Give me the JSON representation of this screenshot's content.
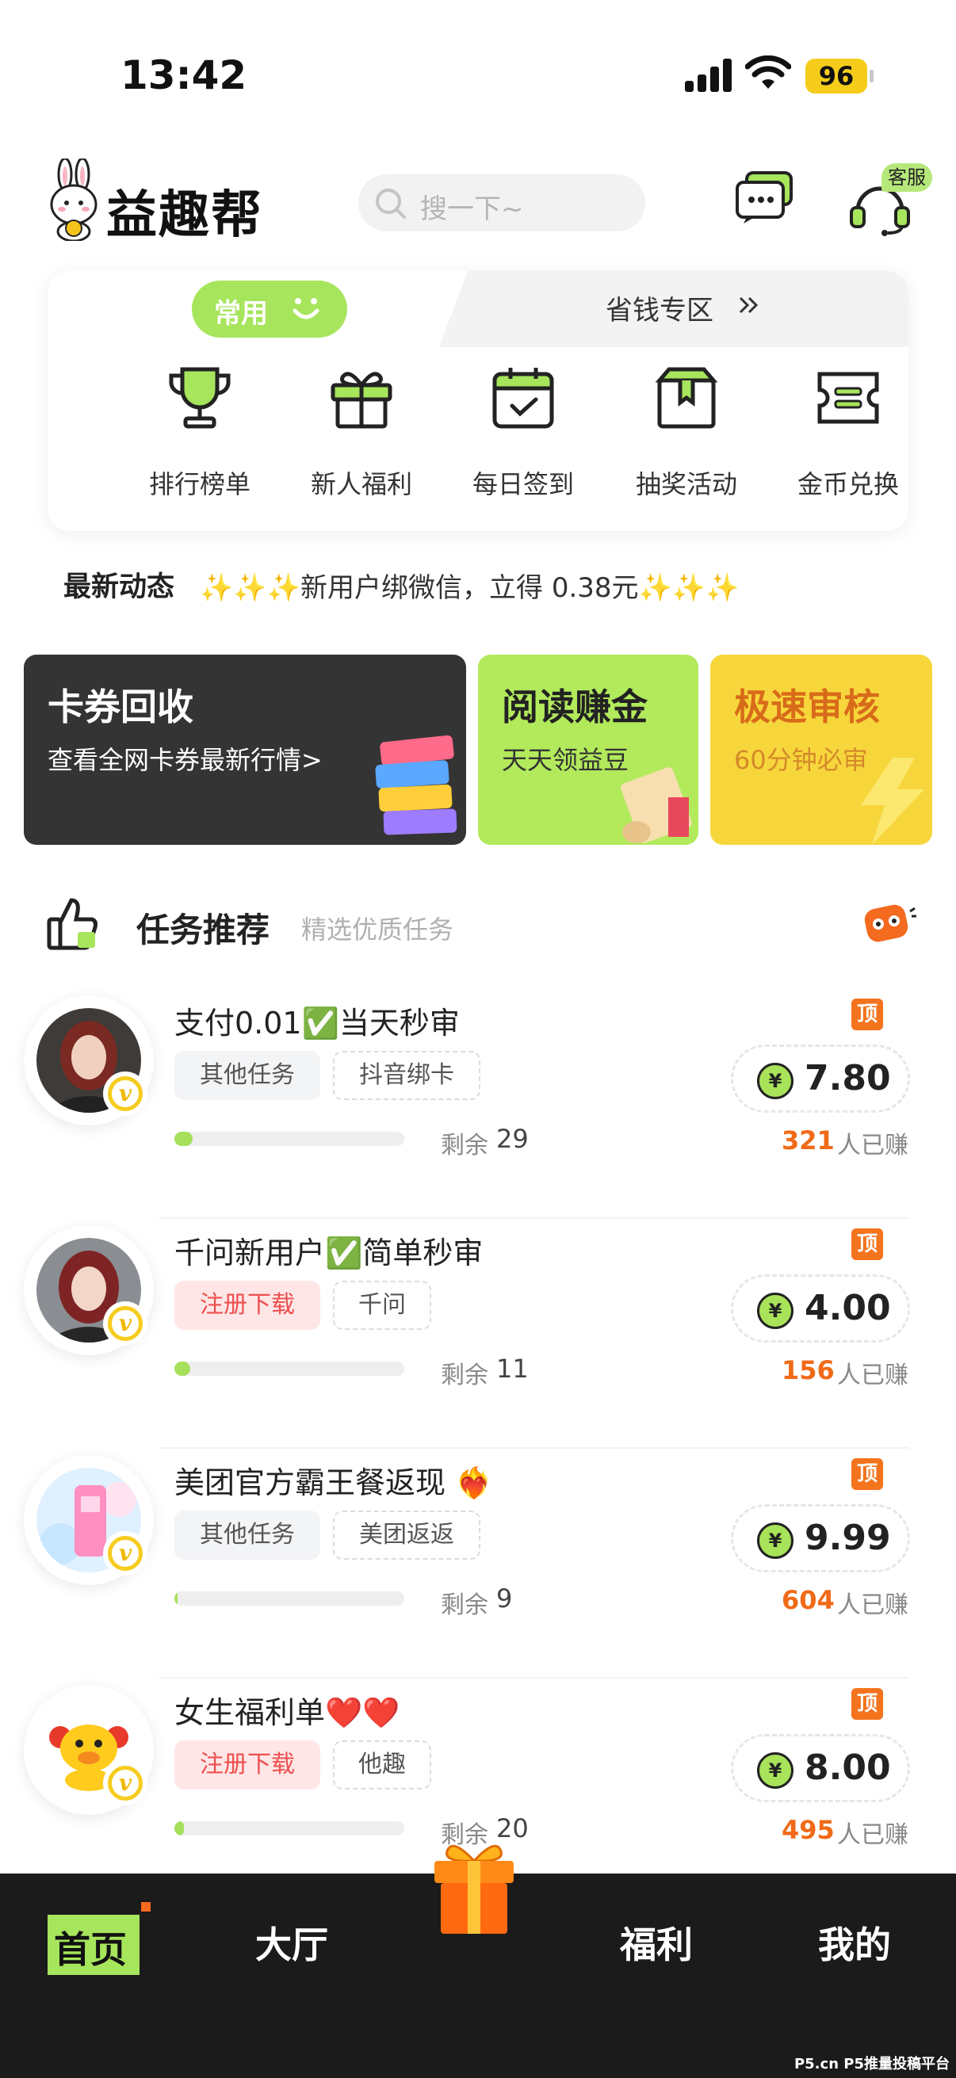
{
  "status_bar": {
    "time": "13:42",
    "battery": "96"
  },
  "header": {
    "app_name": "益趣帮",
    "search_placeholder": "搜一下~",
    "customer_service_tag": "客服"
  },
  "quick_card": {
    "tab_common": "常用",
    "tab_save": "省钱专区",
    "items": [
      {
        "label": "排行榜单",
        "icon": "trophy-icon"
      },
      {
        "label": "新人福利",
        "icon": "gift-icon"
      },
      {
        "label": "每日签到",
        "icon": "calendar-check-icon"
      },
      {
        "label": "抽奖活动",
        "icon": "prize-box-icon"
      },
      {
        "label": "金币兑换",
        "icon": "coupon-icon"
      }
    ]
  },
  "news": {
    "title": "最新动态",
    "text": "新用户绑微信，立得 0.38元"
  },
  "banners": {
    "cards": {
      "title": "卡券回收",
      "subtitle": "查看全网卡券最新行情>"
    },
    "read": {
      "title": "阅读赚金",
      "subtitle": "天天领益豆"
    },
    "audit": {
      "title": "极速审核",
      "subtitle": "60分钟必审"
    }
  },
  "section": {
    "title": "任务推荐",
    "subtitle": "精选优质任务"
  },
  "tasks": [
    {
      "title": "支付0.01✅当天秒审",
      "tag1": "其他任务",
      "tag2": "抖音绑卡",
      "remain_label": "剩余",
      "remain": "29",
      "progress": 0.08,
      "top": "顶",
      "amount": "7.80",
      "earned": "321",
      "earned_label": "人已赚",
      "tag1_style": "gray"
    },
    {
      "title": "千问新用户✅简单秒审",
      "tag1": "注册下载",
      "tag2": "千问",
      "remain_label": "剩余",
      "remain": "11",
      "progress": 0.07,
      "top": "顶",
      "amount": "4.00",
      "earned": "156",
      "earned_label": "人已赚",
      "tag1_style": "pink"
    },
    {
      "title": "美团官方霸王餐返现 ❤️‍🔥",
      "tag1": "其他任务",
      "tag2": "美团返返",
      "remain_label": "剩余",
      "remain": "9",
      "progress": 0.01,
      "top": "顶",
      "amount": "9.99",
      "earned": "604",
      "earned_label": "人已赚",
      "tag1_style": "gray"
    },
    {
      "title": "女生福利单❤️❤️",
      "tag1": "注册下载",
      "tag2": "他趣",
      "remain_label": "剩余",
      "remain": "20",
      "progress": 0.04,
      "top": "顶",
      "amount": "8.00",
      "earned": "495",
      "earned_label": "人已赚",
      "tag1_style": "pink"
    }
  ],
  "bottom_nav": {
    "home": "首页",
    "hall": "大厅",
    "welfare": "福利",
    "mine": "我的"
  },
  "watermark": "P5.cn P5推量投稿平台",
  "colors": {
    "accent_green": "#a6e55c",
    "accent_orange": "#f06a17",
    "nav_bg": "#1b1b1b"
  }
}
